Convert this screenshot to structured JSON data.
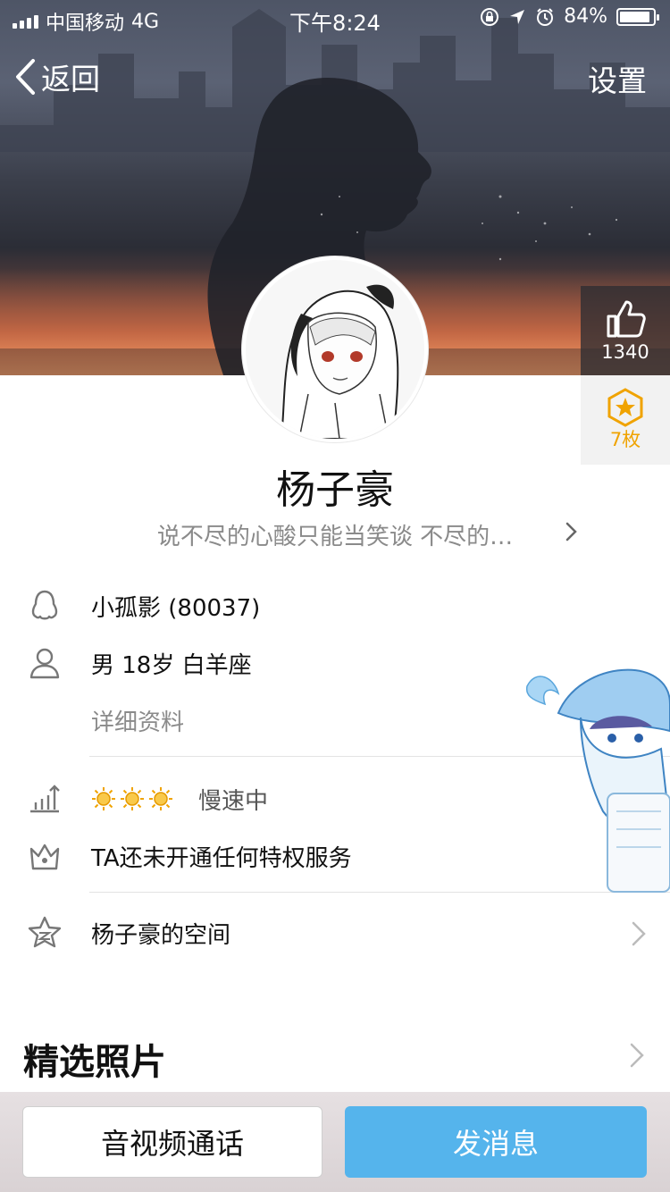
{
  "status": {
    "carrier": "中国移动",
    "network": "4G",
    "time": "下午8:24",
    "battery": "84%"
  },
  "nav": {
    "back_label": "返回",
    "settings_label": "设置"
  },
  "badges": {
    "likes": "1340",
    "medals": "7枚"
  },
  "profile": {
    "name": "杨子豪",
    "signature": "说不尽的心酸只能当笑谈 不尽的…"
  },
  "info": {
    "qq": "小孤影 (80037)",
    "basic": "男  18岁  白羊座",
    "detail_link": "详细资料",
    "level_status": "慢速中",
    "privilege": "TA还未开通任何特权服务",
    "space": "杨子豪的空间"
  },
  "section": {
    "photos_title": "精选照片"
  },
  "actions": {
    "call_label": "音视频通话",
    "message_label": "发消息"
  },
  "colors": {
    "primary": "#55b4ec",
    "medal": "#f0a300",
    "muted": "#8a8a8a"
  }
}
